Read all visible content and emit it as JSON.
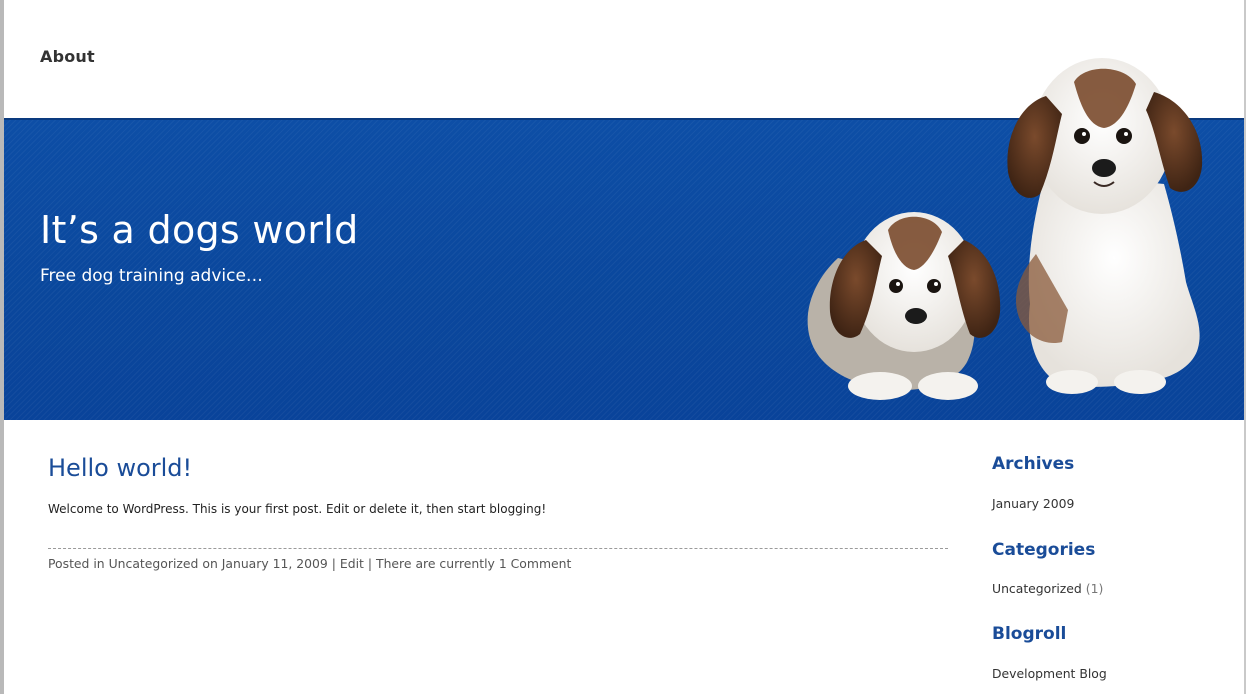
{
  "nav": {
    "about_label": "About"
  },
  "header": {
    "title": "It’s a dogs world",
    "description": "Free dog training advice…"
  },
  "post": {
    "title": "Hello world!",
    "body": "Welcome to WordPress. This is your first post. Edit or delete it, then start blogging!",
    "meta_prefix": "Posted in",
    "category": "Uncategorized",
    "date_text": "on January 11, 2009",
    "separator": "|",
    "edit_label": "Edit",
    "comments_label": "There are currently 1 Comment"
  },
  "sidebar": {
    "archives_title": "Archives",
    "archives_items": [
      "January 2009"
    ],
    "categories_title": "Categories",
    "categories_items": [
      {
        "label": "Uncategorized",
        "count": "(1)"
      }
    ],
    "blogroll_title": "Blogroll",
    "blogroll_items": [
      "Development Blog"
    ]
  },
  "colors": {
    "banner": "#0b4aa0",
    "title_blue": "#1a4c98",
    "text": "#222222"
  }
}
